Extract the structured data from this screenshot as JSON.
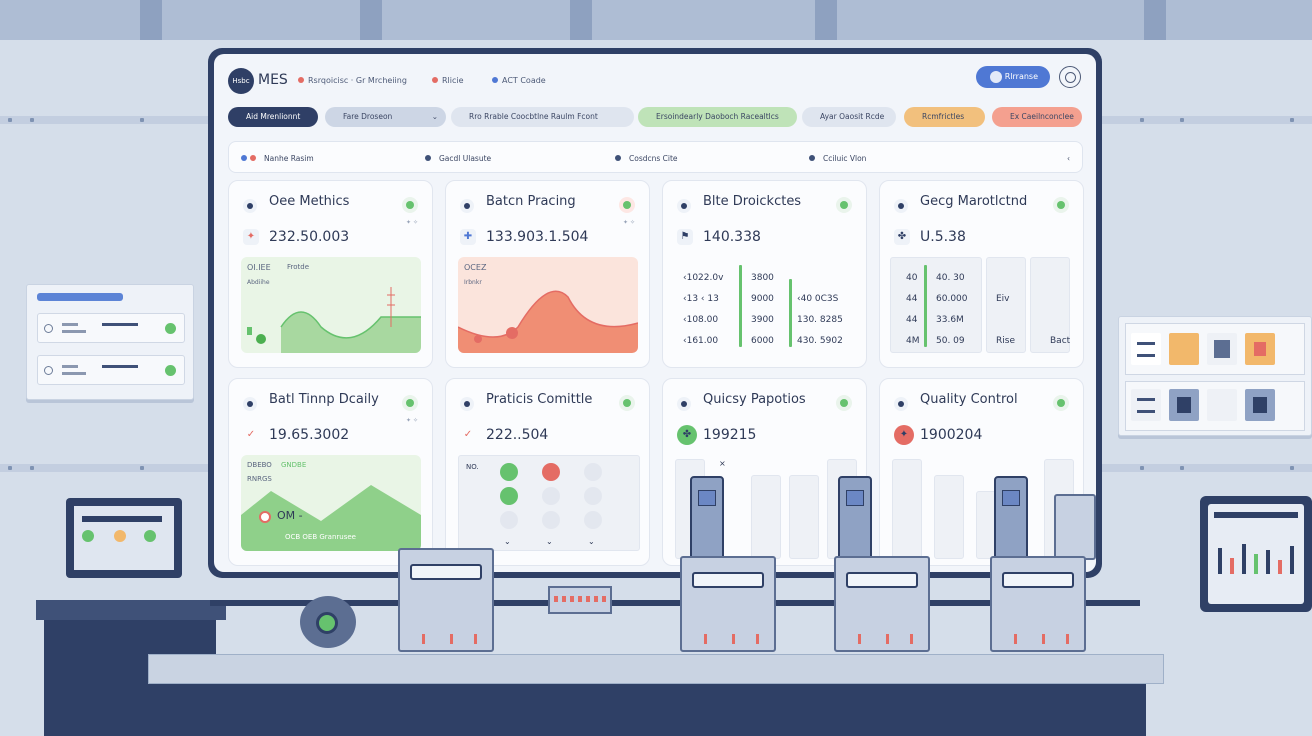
{
  "app": {
    "logo_text": "Hsbc",
    "name": "MES"
  },
  "nav": [
    {
      "label": "Rsrqoicisc · Gr Mrcheiing",
      "icon": "home-icon"
    },
    {
      "label": "Rlicie",
      "icon": "flag-icon"
    },
    {
      "label": "ACT Coade",
      "icon": "chart-icon"
    }
  ],
  "user_button": {
    "label": "Rlrranse"
  },
  "pills": [
    {
      "label": "Aid Mrenlionnt"
    },
    {
      "label": "Fare Droseon"
    },
    {
      "label": "Rro Rrable Coocbtlne Raulm Fcont"
    },
    {
      "label": "Ersoindearly Daoboch Racealtlcs"
    },
    {
      "label": "Ayar Oaosit Rcde"
    },
    {
      "label": "Rcmfrictles"
    },
    {
      "label": "Ex Caeilnconclee"
    }
  ],
  "filters": [
    {
      "label": "Nanhe Rasim"
    },
    {
      "label": "Gacdl Ulasute"
    },
    {
      "label": "Cosdcns Cite"
    },
    {
      "label": "Cciluic Vlon"
    }
  ],
  "cards": [
    {
      "title": "Oee Methics",
      "value": "232.50.003",
      "chart_label_1": "OI.IEE",
      "chart_label_2": "Frotde",
      "chart_label_3": "Abdiihe"
    },
    {
      "title": "Batcn Pracing",
      "value": "133.903.1.504",
      "chart_label_1": "OCEZ",
      "chart_label_2": "Irbnkr"
    },
    {
      "title": "Blte Droickctes",
      "value": "140.338",
      "rows": [
        [
          "‹1022.0v",
          "3800",
          ""
        ],
        [
          "‹13 ‹ 13",
          "9000",
          "‹40 0C3S"
        ],
        [
          "‹108.00",
          "3900",
          "130. 8285"
        ],
        [
          "‹161.00",
          "6000",
          "430. 5902"
        ]
      ]
    },
    {
      "title": "Gecg Marotlctnd",
      "value": "U.5.38",
      "rows": [
        [
          "40",
          "40. 30"
        ],
        [
          "44",
          "60.000"
        ],
        [
          "44",
          "33.6M"
        ],
        [
          "4M",
          "50. 09"
        ]
      ],
      "extra_1": "Eiv",
      "extra_2": "Rise",
      "extra_3": "Bact"
    },
    {
      "title": "Batl Tinnp Dcaily",
      "value": "19.65.3002",
      "chart_label_1": "DBEBO",
      "chart_label_2": "GNDBE",
      "chart_label_3": "RNRGS",
      "chart_label_4": "OM -",
      "chart_label_5": "OCB OEB Granrusee"
    },
    {
      "title": "Praticis Comittle",
      "value": "222..504",
      "chart_label_1": "NO."
    },
    {
      "title": "Quicsy Papotios",
      "value": "199215",
      "chart_label_1": "×"
    },
    {
      "title": "Quality Control",
      "value": "1900204"
    }
  ],
  "colors": {
    "accent_blue": "#4f78d4",
    "navy": "#2f3f66",
    "green": "#66c26e",
    "red": "#e46c64",
    "orange": "#f2b86b",
    "salmon": "#f4a08f"
  }
}
